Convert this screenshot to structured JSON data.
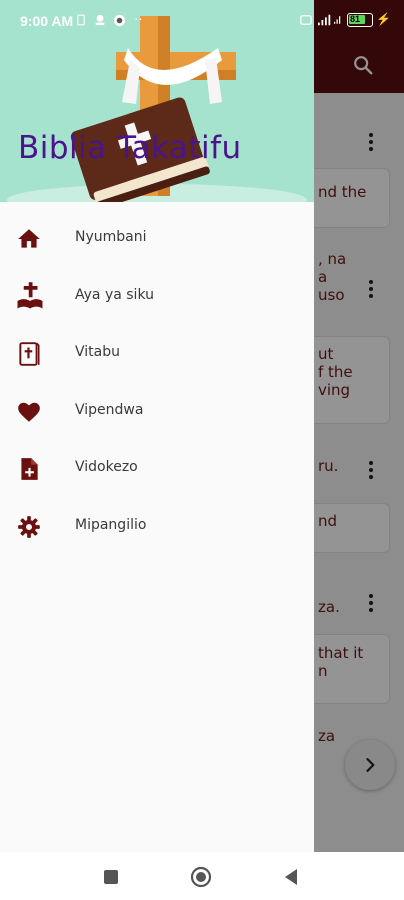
{
  "status_bar": {
    "time": "9:00 AM",
    "battery": "81"
  },
  "drawer": {
    "title": "Biblia Takatifu",
    "items": [
      {
        "label": "Nyumbani",
        "icon": "home-icon"
      },
      {
        "label": "Aya ya siku",
        "icon": "bible-cross-icon"
      },
      {
        "label": "Vitabu",
        "icon": "book-cross-icon"
      },
      {
        "label": "Vipendwa",
        "icon": "heart-icon"
      },
      {
        "label": "Vidokezo",
        "icon": "note-add-icon"
      },
      {
        "label": "Mipangilio",
        "icon": "gear-icon"
      }
    ]
  },
  "background": {
    "snippets": [
      "nd the",
      ", na\na\nuso",
      "ut\nf the\nving",
      "ru.",
      "nd",
      "za.",
      "that it\nn",
      "za"
    ]
  },
  "colors": {
    "accent": "#5a0e0e",
    "icon": "#6b1010",
    "title": "#4a148c",
    "header_bg": "#a6e3cf"
  }
}
